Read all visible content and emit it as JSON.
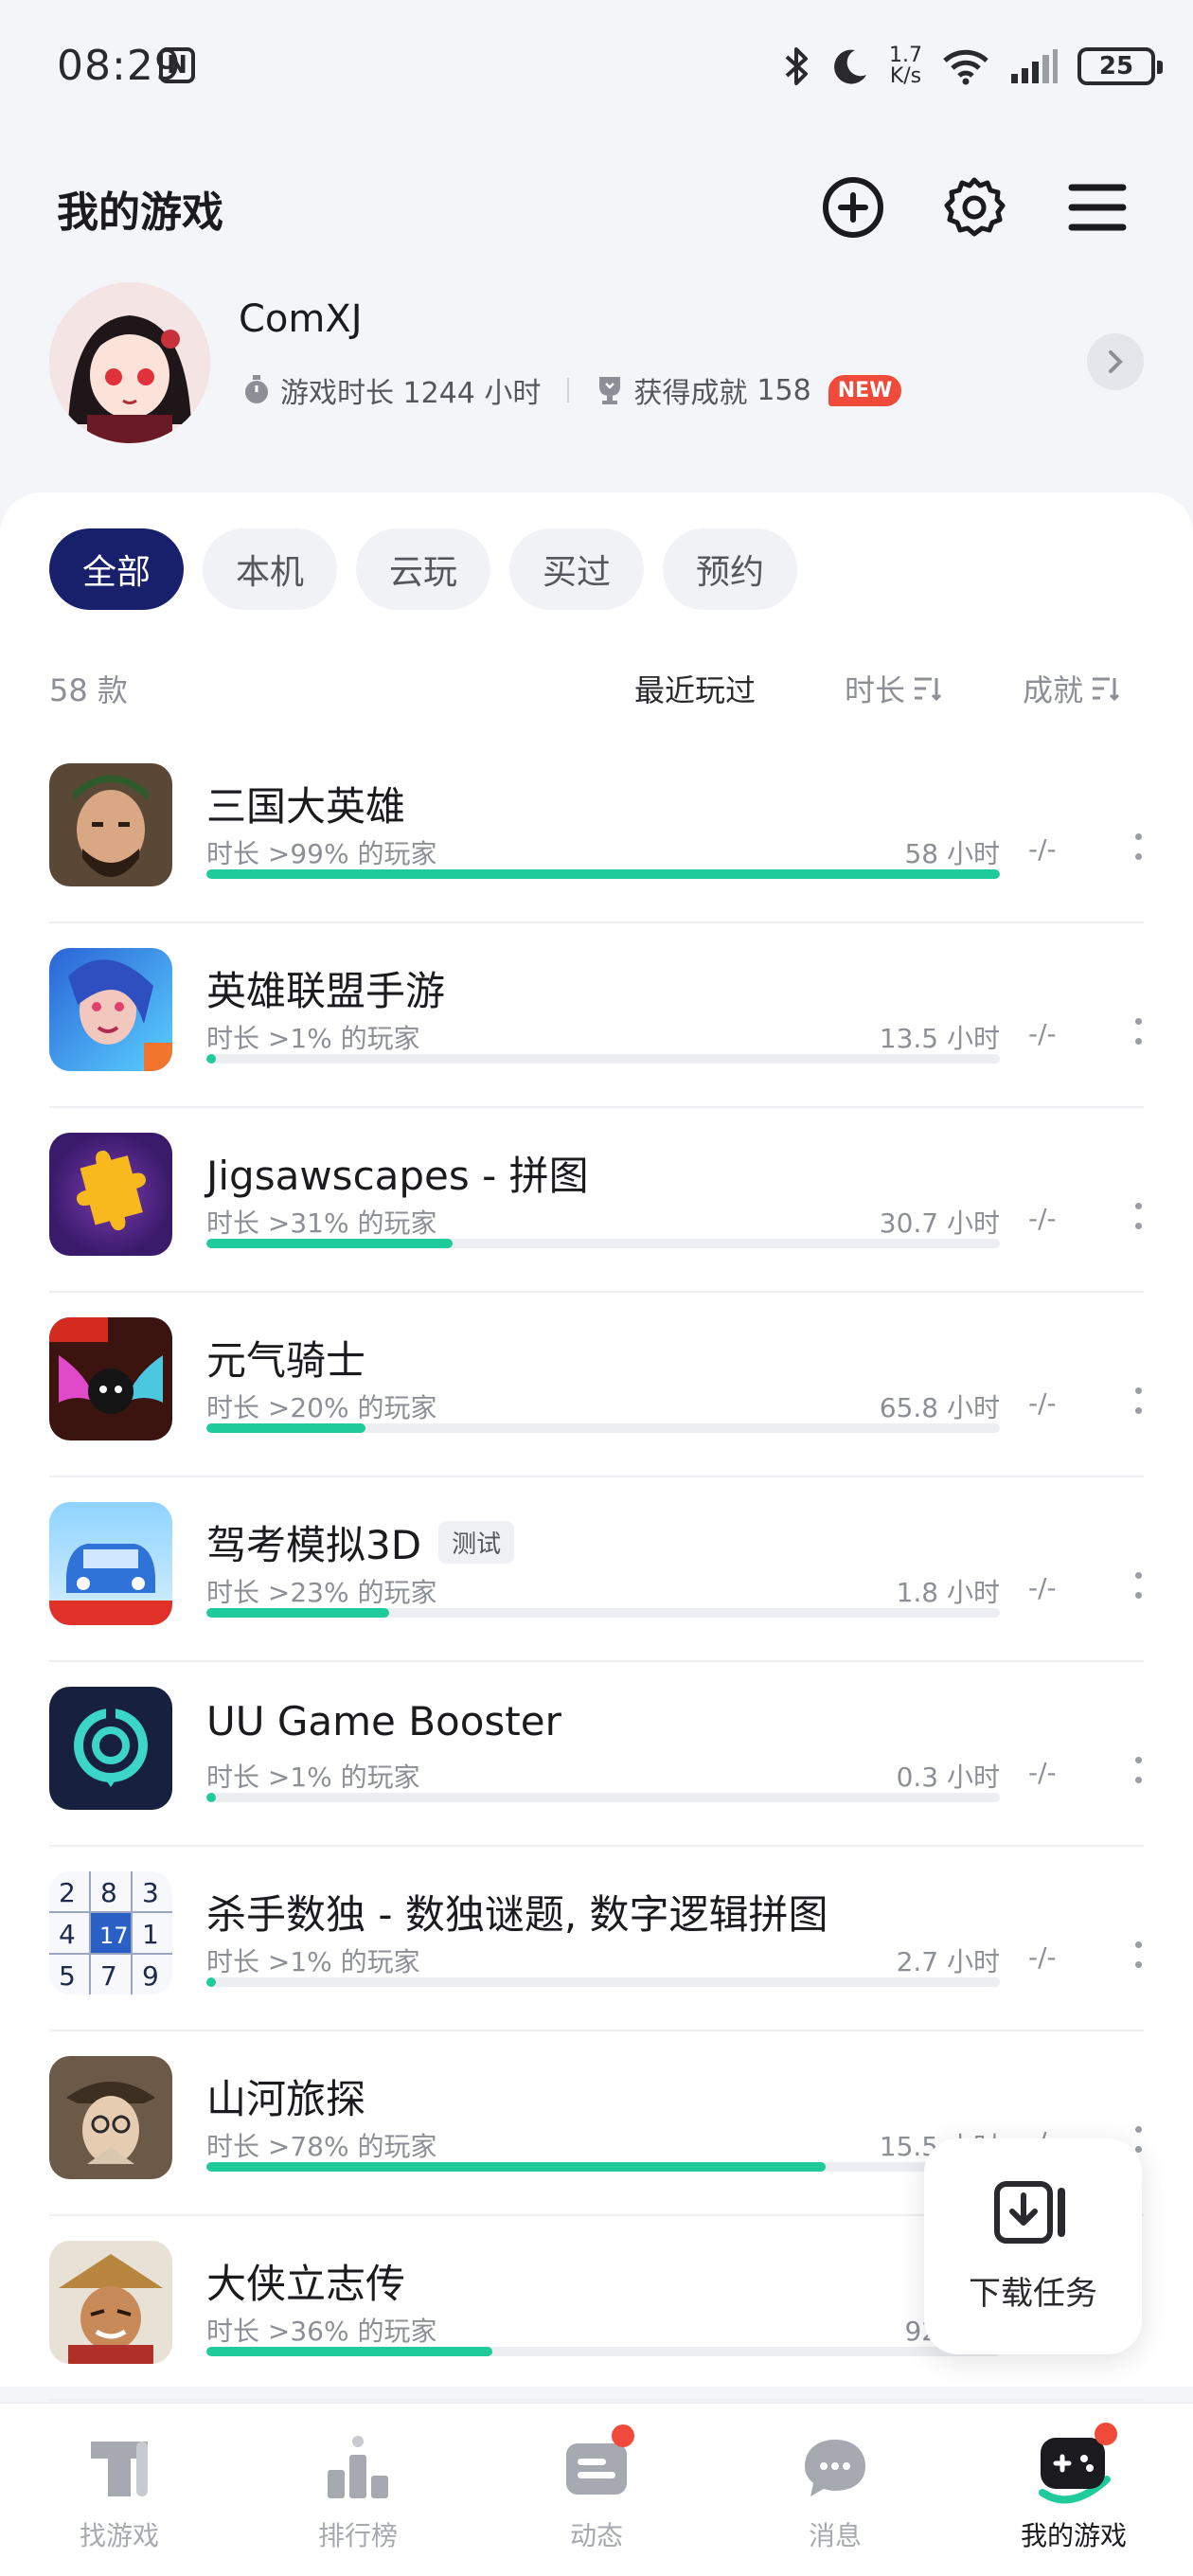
{
  "status_bar": {
    "time": "08:29",
    "nfc": "N",
    "speed_value": "1.7",
    "speed_unit": "K/s",
    "battery": "25",
    "icons": [
      "bluetooth-icon",
      "moon-icon",
      "wifi-icon",
      "signal-icon"
    ]
  },
  "header": {
    "title": "我的游戏",
    "actions": [
      "add-icon",
      "gear-icon",
      "menu-icon"
    ]
  },
  "profile": {
    "name": "ComXJ",
    "playtime": "游戏时长 1244 小时",
    "achievements_label": "获得成就",
    "achievements_count": "158",
    "new_badge": "NEW"
  },
  "filters": [
    "全部",
    "本机",
    "云玩",
    "买过",
    "预约"
  ],
  "active_filter": 0,
  "sort": {
    "count": "58 款",
    "recent": "最近玩过",
    "duration": "时长",
    "achievement": "成就"
  },
  "games": [
    {
      "name": "三国大英雄",
      "tag": "",
      "pct": "时长 >99% 的玩家",
      "hours": "58 小时",
      "ach": "-/-",
      "progress": 1.0
    },
    {
      "name": "英雄联盟手游",
      "tag": "",
      "pct": "时长 >1% 的玩家",
      "hours": "13.5 小时",
      "ach": "-/-",
      "progress": 0.01
    },
    {
      "name": "Jigsawscapes - 拼图",
      "tag": "",
      "pct": "时长 >31% 的玩家",
      "hours": "30.7 小时",
      "ach": "-/-",
      "progress": 0.31
    },
    {
      "name": "元气骑士",
      "tag": "",
      "pct": "时长 >20% 的玩家",
      "hours": "65.8 小时",
      "ach": "-/-",
      "progress": 0.2
    },
    {
      "name": "驾考模拟3D",
      "tag": "测试",
      "pct": "时长 >23% 的玩家",
      "hours": "1.8 小时",
      "ach": "-/-",
      "progress": 0.23
    },
    {
      "name": "UU Game Booster",
      "tag": "",
      "pct": "时长 >1% 的玩家",
      "hours": "0.3 小时",
      "ach": "-/-",
      "progress": 0.01
    },
    {
      "name": "杀手数独 - 数独谜题, 数字逻辑拼图",
      "tag": "",
      "pct": "时长 >1% 的玩家",
      "hours": "2.7 小时",
      "ach": "-/-",
      "progress": 0.01
    },
    {
      "name": "山河旅探",
      "tag": "",
      "pct": "时长 >78% 的玩家",
      "hours": "15.5 小时",
      "ach": "-/-",
      "progress": 0.78
    },
    {
      "name": "大侠立志传",
      "tag": "",
      "pct": "时长 >36% 的玩家",
      "hours": "92 小时",
      "ach": "",
      "progress": 0.36
    }
  ],
  "download_task": "下载任务",
  "nav": [
    {
      "label": "找游戏",
      "icon": "find-game-icon"
    },
    {
      "label": "排行榜",
      "icon": "ranking-icon"
    },
    {
      "label": "动态",
      "icon": "feed-icon"
    },
    {
      "label": "消息",
      "icon": "message-icon"
    },
    {
      "label": "我的游戏",
      "icon": "my-games-icon"
    }
  ],
  "colors": {
    "accent": "#19206b",
    "progress": "#1fcb9a",
    "badge": "#f04b3a"
  }
}
